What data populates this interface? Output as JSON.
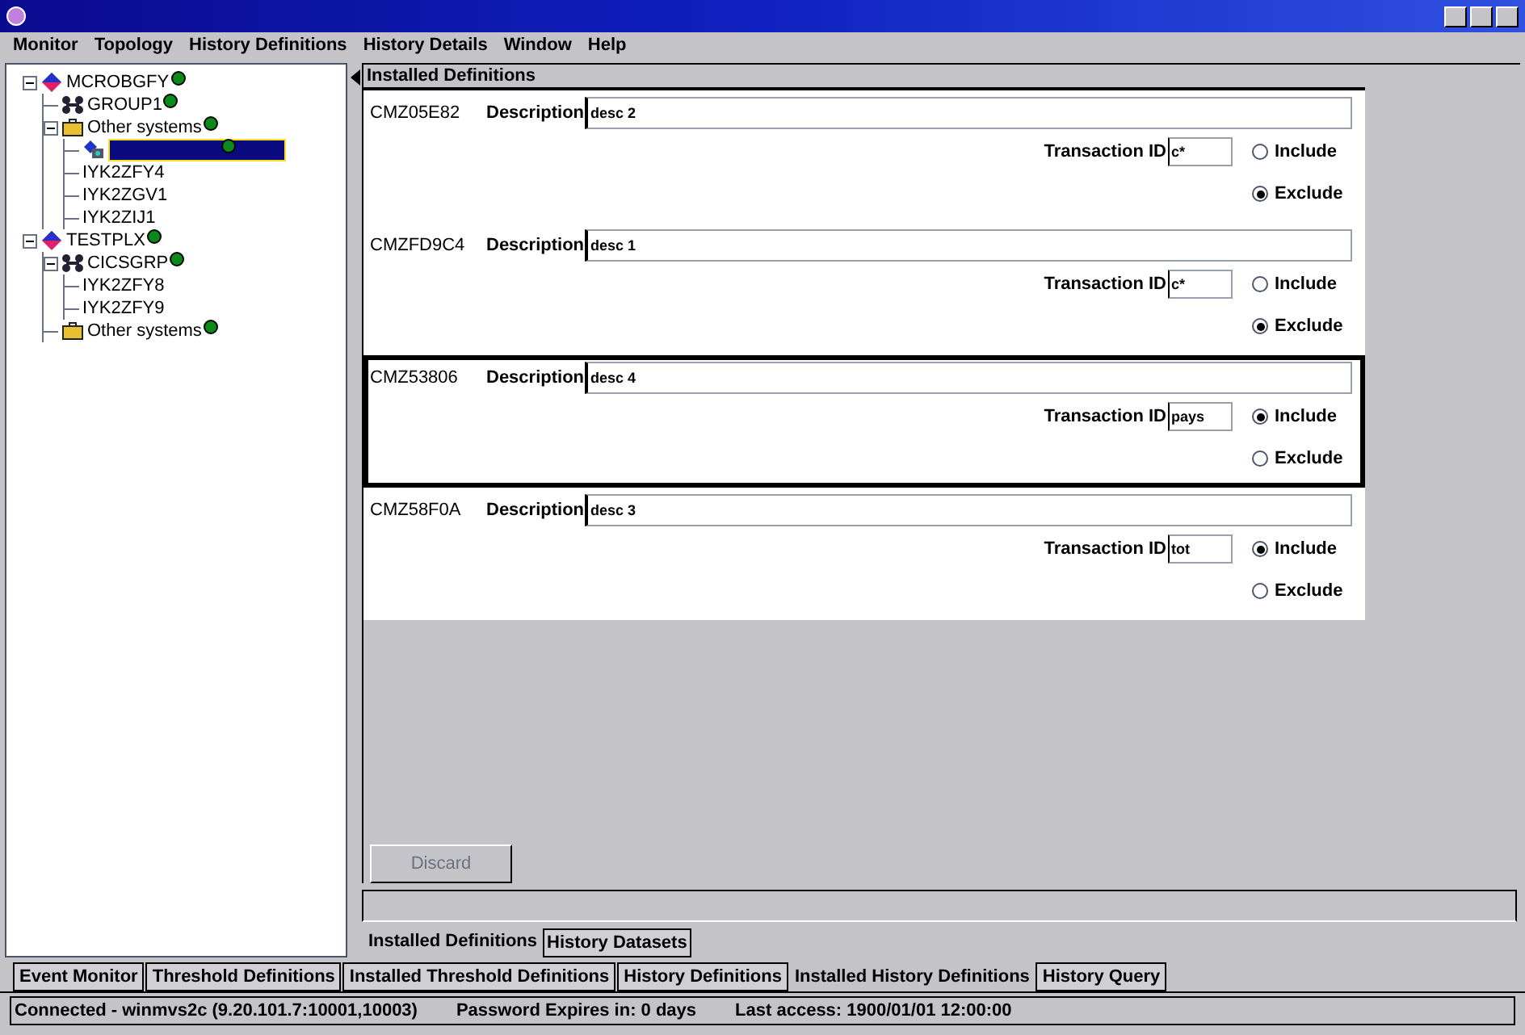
{
  "menu": [
    "Monitor",
    "Topology",
    "History Definitions",
    "History Details",
    "Window",
    "Help"
  ],
  "tree": [
    {
      "kind": "system",
      "label": "MCROBGFY",
      "selected": false,
      "expanded": true,
      "children": [
        {
          "kind": "group",
          "label": "GROUP1",
          "selected": false
        },
        {
          "kind": "folder",
          "label": "Other systems",
          "selected": false,
          "expanded": true,
          "children": [
            {
              "kind": "region",
              "selected": true
            },
            {
              "kind": "leaf",
              "label": "IYK2ZFY4",
              "selected": false
            },
            {
              "kind": "leaf",
              "label": "IYK2ZGV1",
              "selected": false
            },
            {
              "kind": "leaf",
              "label": "IYK2ZIJ1",
              "selected": false
            }
          ]
        }
      ]
    },
    {
      "kind": "system",
      "label": "TESTPLX",
      "selected": false,
      "expanded": true,
      "children": [
        {
          "kind": "group",
          "label": "CICSGRP",
          "selected": false,
          "expanded": true,
          "children": [
            {
              "kind": "leaf",
              "label": "IYK2ZFY8",
              "selected": false
            },
            {
              "kind": "leaf",
              "label": "IYK2ZFY9",
              "selected": false
            }
          ]
        },
        {
          "kind": "folder",
          "label": "Other systems",
          "selected": false
        }
      ]
    }
  ],
  "panel_title": "Installed Definitions",
  "definitions": [
    {
      "id": "CMZ05E82",
      "description_label": "Description",
      "description": "desc 2",
      "transaction_label": "Transaction ID",
      "transaction_id": "c*",
      "focused": false,
      "options": [
        {
          "label": "Include",
          "selected": false
        },
        {
          "label": "Exclude",
          "selected": true
        }
      ]
    },
    {
      "id": "CMZFD9C4",
      "description_label": "Description",
      "description": "desc 1",
      "transaction_label": "Transaction ID",
      "transaction_id": "c*",
      "focused": false,
      "options": [
        {
          "label": "Include",
          "selected": false
        },
        {
          "label": "Exclude",
          "selected": true
        }
      ]
    },
    {
      "id": "CMZ53806",
      "description_label": "Description",
      "description": "desc 4",
      "transaction_label": "Transaction ID",
      "transaction_id": "pays",
      "focused": true,
      "options": [
        {
          "label": "Include",
          "selected": true
        },
        {
          "label": "Exclude",
          "selected": false
        }
      ]
    },
    {
      "id": "CMZ58F0A",
      "description_label": "Description",
      "description": "desc 3",
      "transaction_label": "Transaction ID",
      "transaction_id": "tot",
      "focused": false,
      "options": [
        {
          "label": "Include",
          "selected": true
        },
        {
          "label": "Exclude",
          "selected": false
        }
      ]
    }
  ],
  "discard_button": {
    "label": "Discard",
    "disabled": true
  },
  "inner_tabs": [
    {
      "label": "Installed Definitions",
      "selected": true
    },
    {
      "label": "History Datasets",
      "selected": false
    }
  ],
  "outer_tabs": [
    {
      "label": "Event Monitor",
      "selected": false
    },
    {
      "label": "Threshold Definitions",
      "selected": false
    },
    {
      "label": "Installed Threshold Definitions",
      "selected": false
    },
    {
      "label": "History Definitions",
      "selected": false
    },
    {
      "label": "Installed History Definitions",
      "selected": true
    },
    {
      "label": "History Query",
      "selected": false
    }
  ],
  "status_bar": [
    "Connected - winmvs2c (9.20.101.7:10001,10003)",
    "Password Expires in: 0 days",
    "Last access: 1900/01/01 12:00:00"
  ]
}
